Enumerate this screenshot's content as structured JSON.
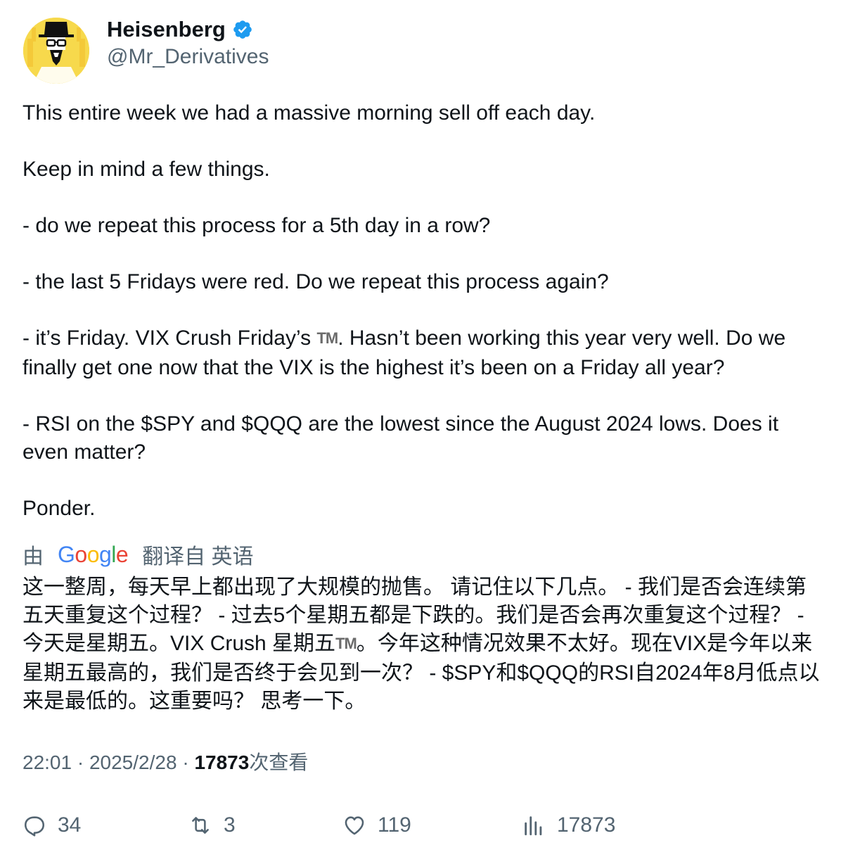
{
  "author": {
    "name": "Heisenberg",
    "handle": "@Mr_Derivatives"
  },
  "tweet": {
    "line1": "This entire week we had a massive morning sell off each day.",
    "line2": "Keep in mind a few things.",
    "line3": "- do we repeat this process for a 5th day in a row?",
    "line4": "- the last 5 Fridays were red. Do we repeat this process again?",
    "line5_a": "- it’s Friday. VIX Crush Friday’s ",
    "line5_tm": "TM",
    "line5_b": ". Hasn’t been working this year very well. Do we finally get one now that the VIX is the highest it’s been on a Friday all year?",
    "line6": "- RSI on the $SPY and $QQQ are the lowest since the August 2024 lows. Does it even matter?",
    "line7": "Ponder."
  },
  "translation_bar": {
    "prefix": "由",
    "google": [
      "G",
      "o",
      "o",
      "g",
      "l",
      "e"
    ],
    "suffix": "翻译自 英语"
  },
  "translation": {
    "part_a": "这一整周，每天早上都出现了大规模的抛售。 请记住以下几点。 - 我们是否会连续第五天重复这个过程？ - 过去5个星期五都是下跌的。我们是否会再次重复这个过程？ - 今天是星期五。VIX Crush 星期五",
    "tm": "TM",
    "part_b": "。今年这种情况效果不太好。现在VIX是今年以来星期五最高的，我们是否终于会见到一次？ - $SPY和$QQQ的RSI自2024年8月低点以来是最低的。这重要吗？ 思考一下。"
  },
  "meta": {
    "time": "22:01",
    "sep": " · ",
    "date": "2025/2/28",
    "views_count": "17873",
    "views_label": "次查看"
  },
  "actions": {
    "replies": "34",
    "retweets": "3",
    "likes": "119",
    "views": "17873"
  },
  "colors": {
    "text": "#0f1419",
    "secondary": "#536471",
    "verified": "#1d9bf0",
    "avatar_bg": "#f7d94c"
  }
}
